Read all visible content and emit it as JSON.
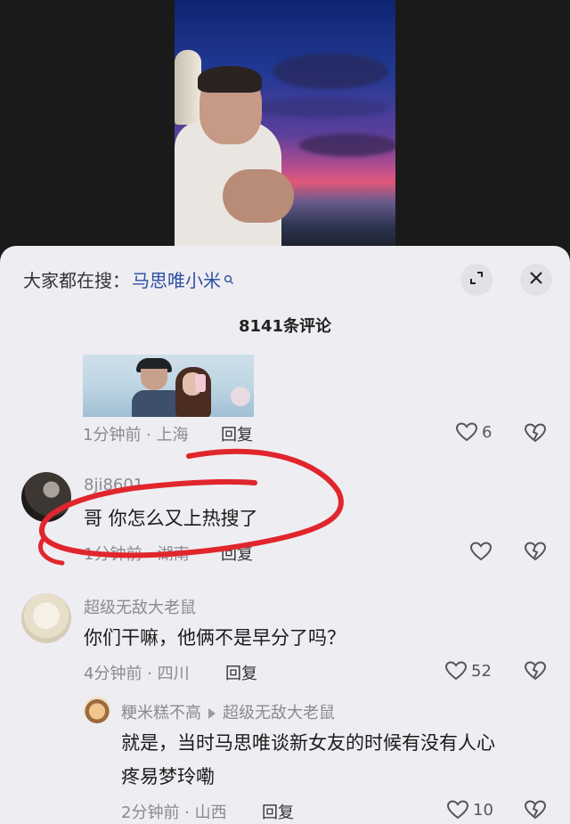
{
  "search": {
    "label": "大家都在搜：",
    "term": "马思唯小米"
  },
  "comment_count": "8141条评论",
  "top_reply": {
    "time_location": "1分钟前 · 上海",
    "reply_label": "回复",
    "likes": "6"
  },
  "comments": [
    {
      "username": "8ji8601",
      "text": "哥 你怎么又上热搜了",
      "time_location": "1分钟前 · 湖南",
      "reply_label": "回复",
      "likes": ""
    },
    {
      "username": "超级无敌大老鼠",
      "text": "你们干嘛，他俩不是早分了吗？",
      "time_location": "4分钟前 · 四川",
      "reply_label": "回复",
      "likes": "52",
      "replies": [
        {
          "username": "粳米糕不高",
          "reply_to": "超级无敌大老鼠",
          "text_line1": "就是，当时马思唯谈新女友的时候有没有人心",
          "text_line2": "疼易梦玲嘞",
          "time_location": "2分钟前 · 山西",
          "reply_label": "回复",
          "likes": "10"
        }
      ]
    }
  ],
  "colors": {
    "sheet_bg": "#eeedf2",
    "search_term": "#2f4fa3",
    "annotation_red": "#e0262c"
  },
  "icons": [
    "search-icon",
    "expand-icon",
    "close-icon",
    "heart-icon",
    "broken-heart-icon"
  ]
}
